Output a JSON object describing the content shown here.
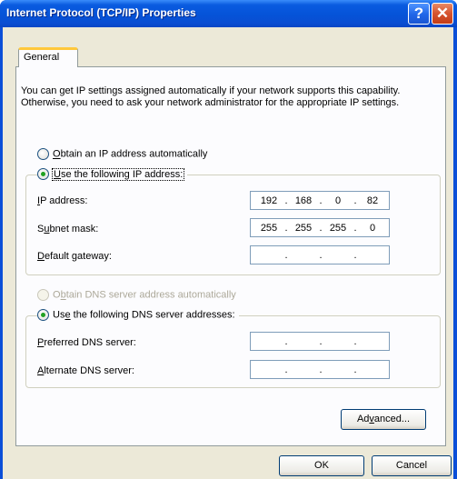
{
  "window": {
    "title": "Internet Protocol (TCP/IP) Properties"
  },
  "titlebar_buttons": {
    "help": "?",
    "close": "✕"
  },
  "tabs": [
    {
      "label": "General"
    }
  ],
  "intro_text": "You can get IP settings assigned automatically if your network supports this capability. Otherwise, you need to ask your network administrator for the appropriate IP settings.",
  "ip_section": {
    "auto_option": {
      "label": "Obtain an IP address automatically",
      "selected": false
    },
    "manual_option": {
      "label": "Use the following IP address:",
      "selected": true
    },
    "fields": {
      "ip_address": {
        "label": "IP address:",
        "octets": [
          "192",
          "168",
          "0",
          "82"
        ]
      },
      "subnet_mask": {
        "label": "Subnet mask:",
        "octets": [
          "255",
          "255",
          "255",
          "0"
        ]
      },
      "default_gateway": {
        "label": "Default gateway:",
        "octets": [
          "",
          "",
          "",
          ""
        ]
      }
    }
  },
  "dns_section": {
    "auto_option": {
      "label": "Obtain DNS server address automatically",
      "selected": false,
      "enabled": false
    },
    "manual_option": {
      "label": "Use the following DNS server addresses:",
      "selected": true
    },
    "fields": {
      "preferred": {
        "label": "Preferred DNS server:",
        "octets": [
          "",
          "",
          "",
          ""
        ]
      },
      "alternate": {
        "label": "Alternate DNS server:",
        "octets": [
          "",
          "",
          "",
          ""
        ]
      }
    }
  },
  "buttons": {
    "advanced": "Advanced...",
    "ok": "OK",
    "cancel": "Cancel"
  }
}
